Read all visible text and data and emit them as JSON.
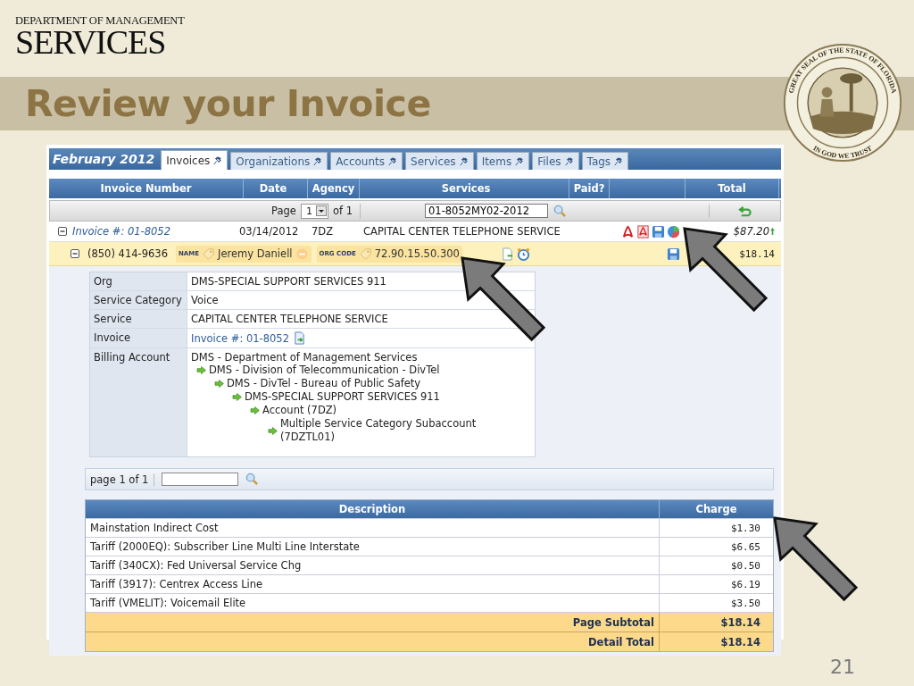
{
  "slide": {
    "org_line1": "DEPARTMENT OF MANAGEMENT",
    "org_line2": "SERVICES",
    "title": "Review your Invoice",
    "seal_text": "GREAT SEAL OF THE STATE OF FLORIDA",
    "seal_motto": "IN GOD WE TRUST",
    "page_number": "21"
  },
  "app": {
    "period": "February 2012",
    "tabs": [
      {
        "label": "Invoices",
        "selected": true
      },
      {
        "label": "Organizations",
        "selected": false
      },
      {
        "label": "Accounts",
        "selected": false
      },
      {
        "label": "Services",
        "selected": false
      },
      {
        "label": "Items",
        "selected": false
      },
      {
        "label": "Files",
        "selected": false
      },
      {
        "label": "Tags",
        "selected": false
      }
    ],
    "columns": [
      "Invoice Number",
      "Date",
      "Agency",
      "Services",
      "Paid?",
      "Total"
    ],
    "pager": {
      "label": "Page",
      "page": "1",
      "of": "of 1",
      "search_value": "01-8052MY02-2012"
    },
    "invoice": {
      "number": "Invoice #: 01-8052",
      "date": "03/14/2012",
      "agency": "7DZ",
      "service": "CAPITAL CENTER TELEPHONE SERVICE",
      "total": "$87.20",
      "expanded": true
    },
    "line": {
      "phone": "(850) 414-9636",
      "expanded": true,
      "total": "$18.14",
      "tags": [
        {
          "label": "NAME",
          "value": "Jeremy Daniell"
        },
        {
          "label": "ORG CODE",
          "value": "72.90.15.50.300"
        }
      ]
    },
    "details": [
      {
        "label": "Org",
        "value": "DMS-SPECIAL SUPPORT SERVICES 911",
        "kind": "text"
      },
      {
        "label": "Service Category",
        "value": "Voice",
        "kind": "text"
      },
      {
        "label": "Service",
        "value": "CAPITAL CENTER TELEPHONE SERVICE",
        "kind": "text"
      },
      {
        "label": "Invoice",
        "value": "Invoice #: 01-8052",
        "kind": "link"
      }
    ],
    "billing": {
      "label": "Billing Account",
      "tree": {
        "name": "DMS - Department of Management Services",
        "children": [
          {
            "name": "DMS - Division of Telecommunication - DivTel",
            "children": [
              {
                "name": "DMS - DivTel - Bureau of Public Safety",
                "children": [
                  {
                    "name": "DMS-SPECIAL SUPPORT SERVICES 911",
                    "children": [
                      {
                        "name": "Account (7DZ)",
                        "children": [
                          {
                            "name": "Multiple Service Category Subaccount (7DZTL01)"
                          }
                        ]
                      }
                    ]
                  }
                ]
              }
            ]
          }
        ]
      }
    },
    "charges_pager": {
      "label": "page 1 of 1"
    },
    "charges": {
      "columns": [
        "Description",
        "Charge"
      ],
      "rows": [
        {
          "description": "Mainstation Indirect Cost",
          "charge": "$1.30"
        },
        {
          "description": "Tariff (2000EQ): Subscriber Line Multi Line Interstate",
          "charge": "$6.65"
        },
        {
          "description": "Tariff (340CX): Fed Universal Service Chg",
          "charge": "$0.50"
        },
        {
          "description": "Tariff (3917): Centrex Access Line",
          "charge": "$6.19"
        },
        {
          "description": "Tariff (VMELIT): Voicemail Elite",
          "charge": "$3.50"
        }
      ],
      "totals": [
        {
          "label": "Page Subtotal",
          "value": "$18.14"
        },
        {
          "label": "Detail Total",
          "value": "$18.14"
        }
      ]
    }
  }
}
